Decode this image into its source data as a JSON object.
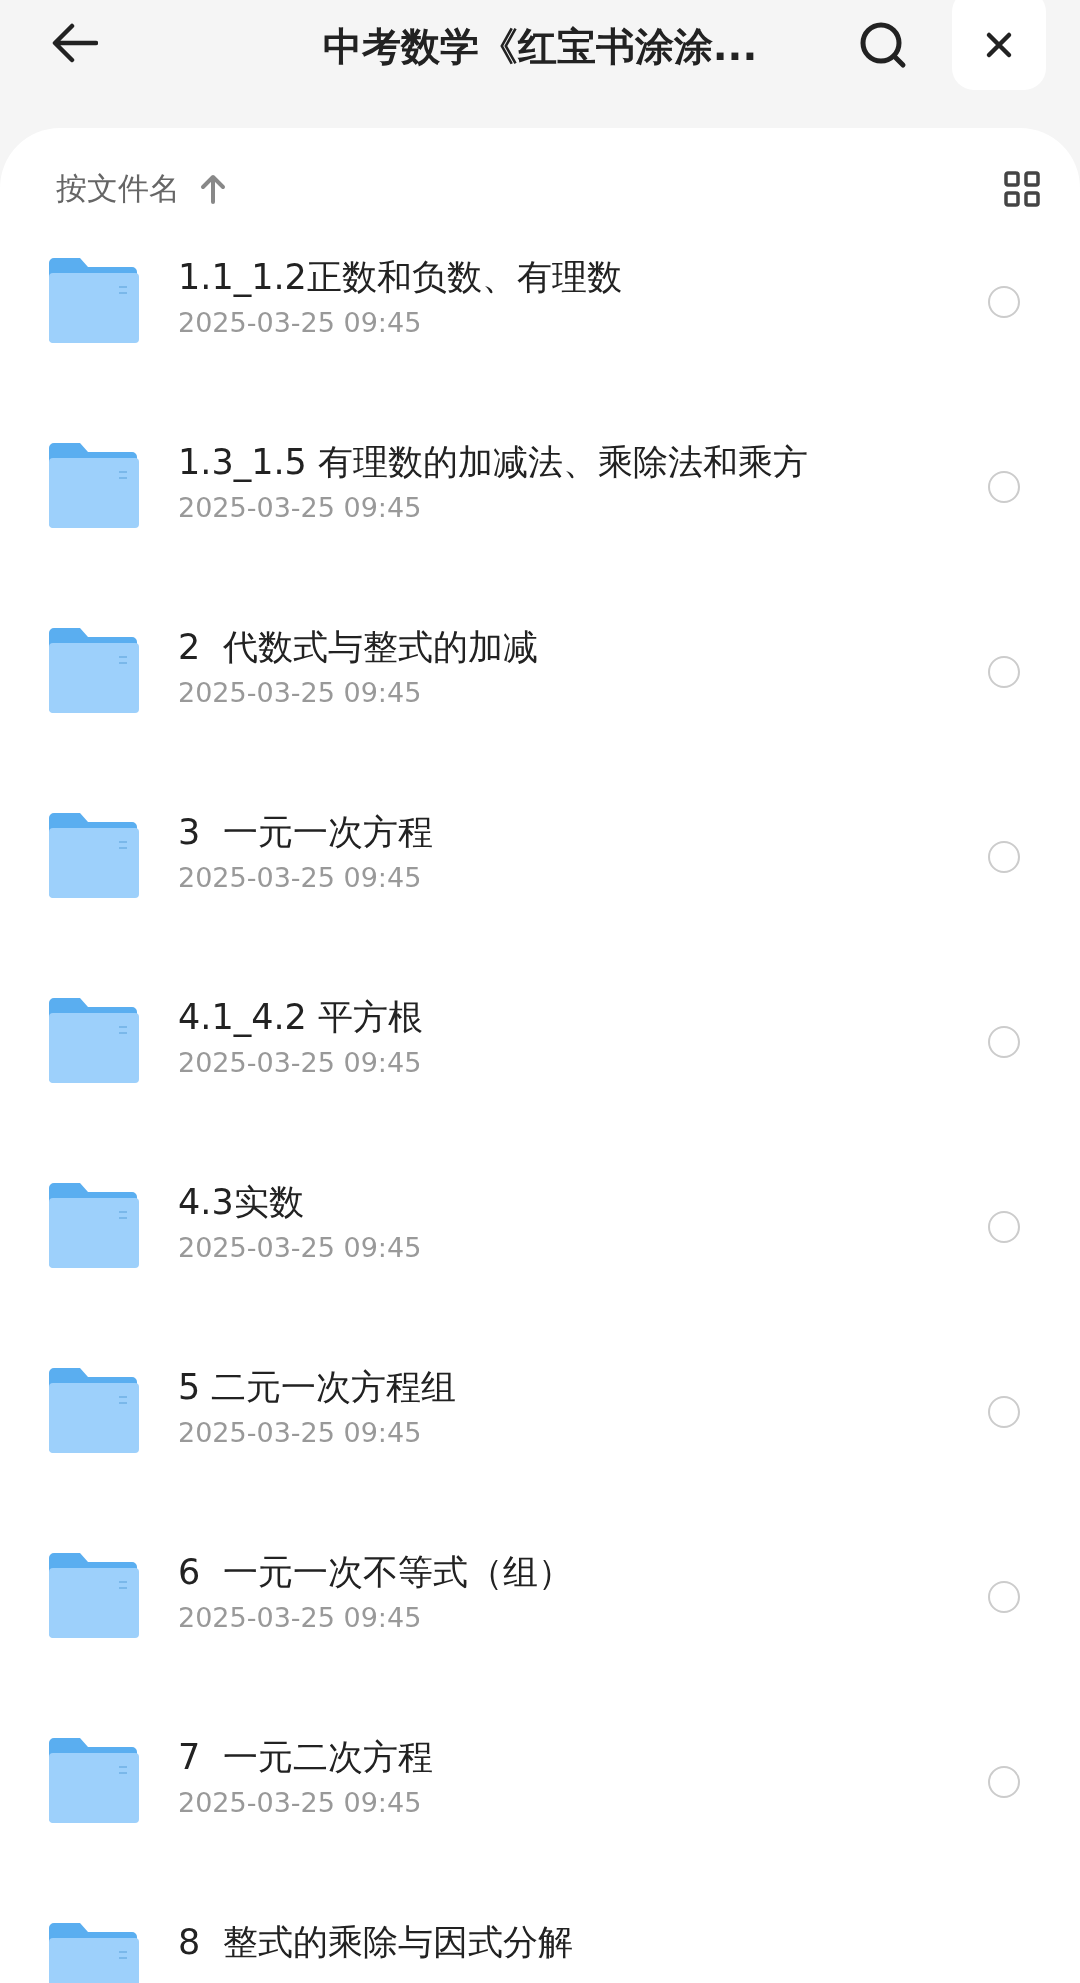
{
  "header": {
    "title": "中考数学《红宝书涂涂..."
  },
  "sort": {
    "label": "按文件名"
  },
  "files": [
    {
      "name": "1.1_1.2正数和负数、有理数",
      "date": "2025-03-25 09:45",
      "selected": false
    },
    {
      "name": "1.3_1.5 有理数的加减法、乘除法和乘方",
      "date": "2025-03-25 09:45",
      "selected": false
    },
    {
      "name": "2  代数式与整式的加减",
      "date": "2025-03-25 09:45",
      "selected": false
    },
    {
      "name": "3  一元一次方程",
      "date": "2025-03-25 09:45",
      "selected": false
    },
    {
      "name": "4.1_4.2 平方根",
      "date": "2025-03-25 09:45",
      "selected": false
    },
    {
      "name": "4.3实数",
      "date": "2025-03-25 09:45",
      "selected": false
    },
    {
      "name": "5 二元一次方程组",
      "date": "2025-03-25 09:45",
      "selected": false
    },
    {
      "name": "6  一元一次不等式（组）",
      "date": "2025-03-25 09:45",
      "selected": false
    },
    {
      "name": "7  一元二次方程",
      "date": "2025-03-25 09:45",
      "selected": false
    },
    {
      "name": "8  整式的乘除与因式分解"
    }
  ]
}
